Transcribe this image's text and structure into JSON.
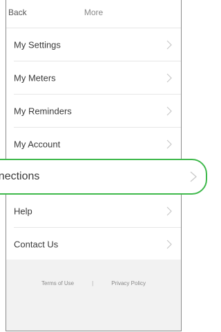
{
  "nav": {
    "back_label": "Back",
    "title": "More"
  },
  "menu": {
    "items": [
      {
        "label": "My Settings"
      },
      {
        "label": "My Meters"
      },
      {
        "label": "My Reminders"
      },
      {
        "label": "My Account"
      },
      {
        "label": "onnections"
      },
      {
        "label": "Help"
      },
      {
        "label": "Contact Us"
      }
    ]
  },
  "footer": {
    "terms_label": "Terms of Use",
    "separator": "|",
    "privacy_label": "Privacy Policy"
  },
  "colors": {
    "highlight_border": "#3db84a",
    "footer_background": "#f2f2f2",
    "chevron": "#c8c8c8"
  }
}
